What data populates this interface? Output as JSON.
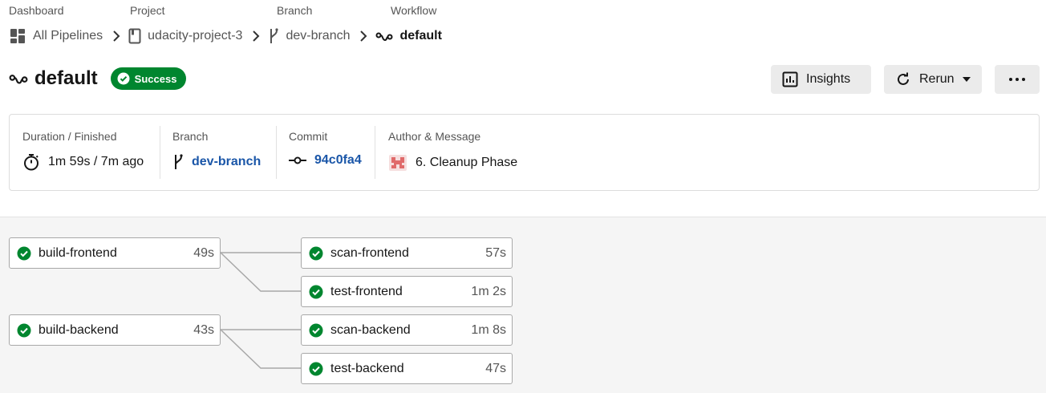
{
  "breadcrumb": {
    "labels": {
      "dashboard": "Dashboard",
      "project": "Project",
      "branch": "Branch",
      "workflow": "Workflow"
    },
    "dashboard": "All Pipelines",
    "project": "udacity-project-3",
    "branch": "dev-branch",
    "workflow": "default"
  },
  "header": {
    "title": "default",
    "status": "Success",
    "insights_label": "Insights",
    "rerun_label": "Rerun"
  },
  "info": {
    "duration_label": "Duration / Finished",
    "duration_value": "1m 59s / 7m ago",
    "branch_label": "Branch",
    "branch_value": "dev-branch",
    "commit_label": "Commit",
    "commit_value": "94c0fa4",
    "author_label": "Author & Message",
    "author_value": "6. Cleanup Phase"
  },
  "jobs": [
    {
      "name": "build-frontend",
      "duration": "49s"
    },
    {
      "name": "scan-frontend",
      "duration": "57s"
    },
    {
      "name": "test-frontend",
      "duration": "1m 2s"
    },
    {
      "name": "build-backend",
      "duration": "43s"
    },
    {
      "name": "scan-backend",
      "duration": "1m 8s"
    },
    {
      "name": "test-backend",
      "duration": "47s"
    }
  ],
  "colors": {
    "success": "#00862f",
    "link": "#1a56a8",
    "avatar": "#e06a6a"
  },
  "icons": {
    "dashboard": "dashboard-icon",
    "project": "bookmark-icon",
    "branch": "branch-icon",
    "workflow": "workflow-icon",
    "timer": "stopwatch-icon",
    "commit": "commit-icon",
    "check": "check-circle-icon",
    "insights": "chart-icon",
    "rerun": "refresh-icon",
    "more": "ellipsis-icon"
  }
}
